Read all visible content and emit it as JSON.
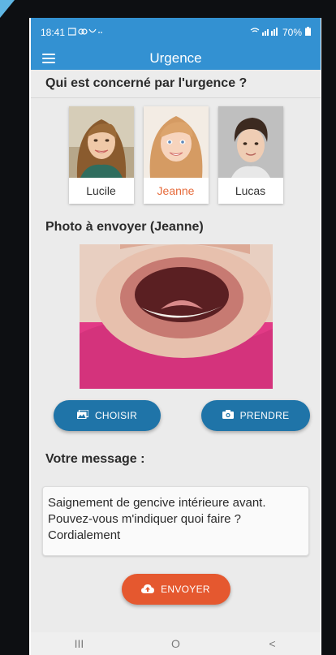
{
  "status": {
    "time": "18:41",
    "battery": "70%"
  },
  "app": {
    "title": "Urgence"
  },
  "sections": {
    "who": "Qui est concerné par l'urgence ?",
    "photo": "Photo à envoyer (Jeanne)",
    "message": "Votre message :"
  },
  "people": [
    {
      "name": "Lucile",
      "selected": false
    },
    {
      "name": "Jeanne",
      "selected": true
    },
    {
      "name": "Lucas",
      "selected": false
    }
  ],
  "buttons": {
    "choisir": "CHOISIR",
    "prendre": "PRENDRE",
    "envoyer": "ENVOYER"
  },
  "message_lines": [
    "Saignement de gencive intérieure avant.",
    "Pouvez-vous m'indiquer quoi faire ?",
    "Cordialement"
  ],
  "colors": {
    "primary": "#3391d2",
    "button": "#1f74a8",
    "accent": "#e5582f",
    "selected_name": "#e66a3a"
  },
  "icons": {
    "menu": "hamburger-menu-icon",
    "choisir": "image-icon",
    "prendre": "camera-icon",
    "envoyer": "cloud-upload-icon"
  },
  "nav": [
    "III",
    "O",
    "<"
  ]
}
